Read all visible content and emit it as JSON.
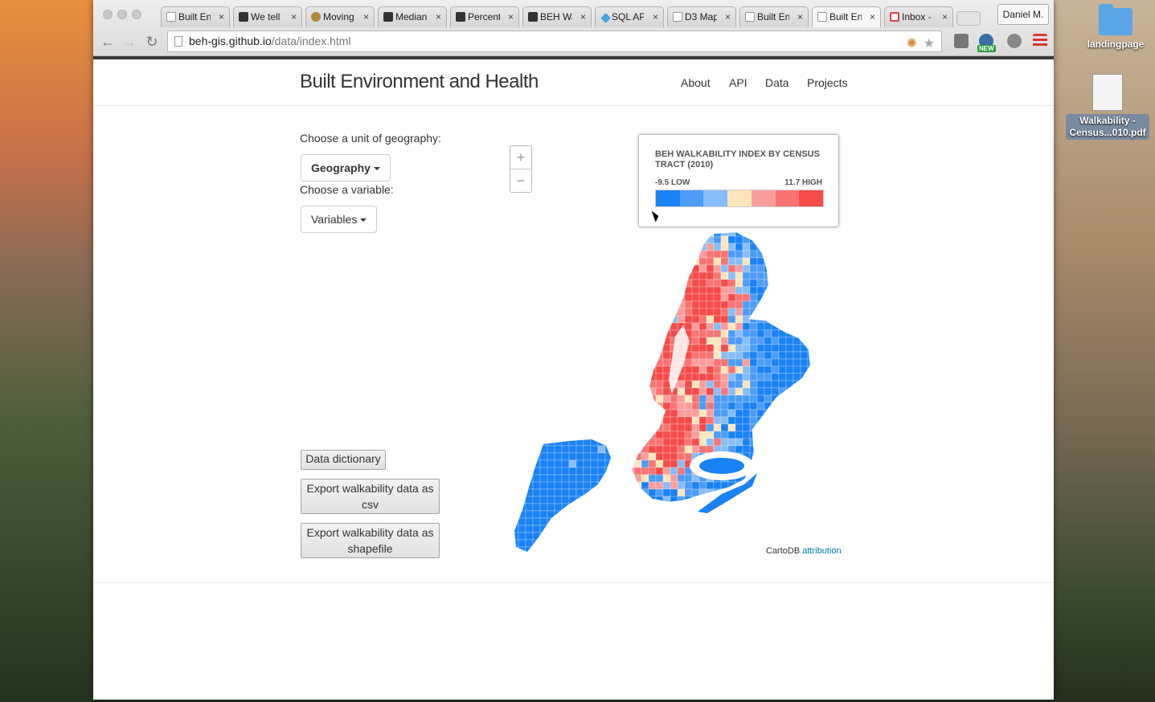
{
  "browser": {
    "tabs": [
      {
        "label": "Built Environment and Health",
        "icon": "page-icon"
      },
      {
        "label": "We tell",
        "icon": "github-icon"
      },
      {
        "label": "Moving",
        "icon": "globe-icon"
      },
      {
        "label": "Median",
        "icon": "github-icon"
      },
      {
        "label": "Percent",
        "icon": "github-icon"
      },
      {
        "label": "BEH Walkability",
        "icon": "github-icon"
      },
      {
        "label": "SQL API",
        "icon": "sql-icon"
      },
      {
        "label": "D3 Map",
        "icon": "page-icon"
      },
      {
        "label": "Built Environment",
        "icon": "page-icon"
      },
      {
        "label": "Built Environment",
        "icon": "page-icon"
      },
      {
        "label": "Inbox -",
        "icon": "gmail-icon"
      }
    ],
    "close_glyph": "×",
    "profile_name": "Daniel M.",
    "url_host": "beh-gis.github.io",
    "url_path": "/data/index.html",
    "new_badge": "NEW"
  },
  "desktop": {
    "folder_label": "landingpage",
    "pdf_label_line1": "Walkability -",
    "pdf_label_line2": "Census...010.pdf"
  },
  "site": {
    "brand": "Built Environment and Health",
    "nav": [
      "About",
      "API",
      "Data",
      "Projects"
    ]
  },
  "controls": {
    "geo_label": "Choose a unit of geography:",
    "geo_button": "Geography",
    "var_label": "Choose a variable:",
    "var_button": "Variables",
    "data_dictionary": "Data dictionary",
    "export_csv_line1": "Export walkability data as",
    "export_csv_line2": "csv",
    "export_shp_line1": "Export walkability data as",
    "export_shp_line2": "shapefile"
  },
  "map": {
    "zoom_in": "+",
    "zoom_out": "−",
    "attribution_prefix": "CartoDB",
    "attribution_link": "attribution"
  },
  "legend": {
    "title": "BEH WALKABILITY INDEX BY CENSUS TRACT (2010)",
    "low_label": "-9.5 LOW",
    "high_label": "11.7 HIGH",
    "colors": [
      "#1a82f5",
      "#4d9cf7",
      "#87bdf9",
      "#fde6bd",
      "#fa9d9d",
      "#f87474",
      "#f54b4b"
    ]
  }
}
